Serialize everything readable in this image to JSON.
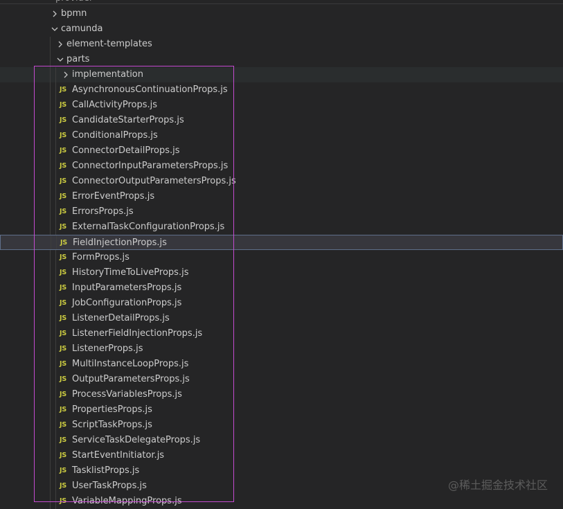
{
  "explorer": {
    "cut_off_label": "provider",
    "folders": [
      {
        "label": "bpmn",
        "expanded": false
      },
      {
        "label": "camunda",
        "expanded": true
      },
      {
        "label": "element-templates",
        "expanded": false
      },
      {
        "label": "parts",
        "expanded": true
      },
      {
        "label": "implementation",
        "expanded": false
      }
    ],
    "files": [
      "AsynchronousContinuationProps.js",
      "CallActivityProps.js",
      "CandidateStarterProps.js",
      "ConditionalProps.js",
      "ConnectorDetailProps.js",
      "ConnectorInputParametersProps.js",
      "ConnectorOutputParametersProps.js",
      "ErrorEventProps.js",
      "ErrorsProps.js",
      "ExternalTaskConfigurationProps.js",
      "FieldInjectionProps.js",
      "FormProps.js",
      "HistoryTimeToLiveProps.js",
      "InputParametersProps.js",
      "JobConfigurationProps.js",
      "ListenerDetailProps.js",
      "ListenerFieldInjectionProps.js",
      "ListenerProps.js",
      "MultiInstanceLoopProps.js",
      "OutputParametersProps.js",
      "ProcessVariablesProps.js",
      "PropertiesProps.js",
      "ScriptTaskProps.js",
      "ServiceTaskDelegateProps.js",
      "StartEventInitiator.js",
      "TasklistProps.js",
      "UserTaskProps.js",
      "VariableMappingProps.js"
    ],
    "file_icon_text": "JS",
    "hovered_item": "implementation",
    "selected_item": "FieldInjectionProps.js"
  },
  "colors": {
    "background": "#252526",
    "text": "#cccccc",
    "js_icon": "#cbcb41",
    "selection_bg": "#37373d",
    "hover_bg": "#2a2d2e",
    "highlight_box": "#c54bd1"
  },
  "watermark": "@稀土掘金技术社区"
}
